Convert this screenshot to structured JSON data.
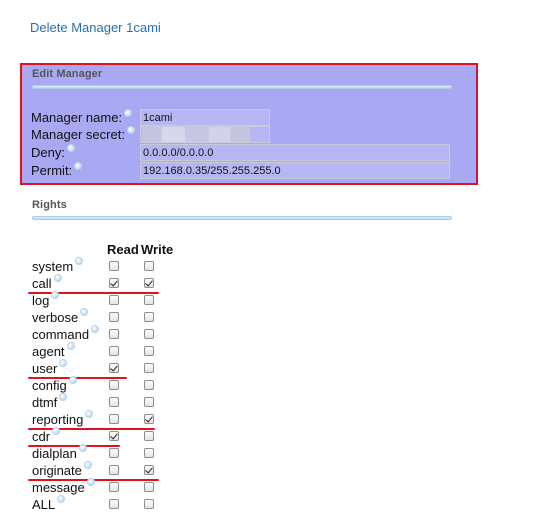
{
  "delete_link": "Delete Manager 1cami",
  "edit_manager": {
    "legend": "Edit Manager",
    "fields": {
      "name": {
        "label": "Manager name:",
        "value": "1cami"
      },
      "secret": {
        "label": "Manager secret:",
        "value": ""
      },
      "deny": {
        "label": "Deny:",
        "value": "0.0.0.0/0.0.0.0"
      },
      "permit": {
        "label": "Permit:",
        "value": "192.168.0.35/255.255.255.0"
      }
    }
  },
  "rights": {
    "legend": "Rights",
    "read_header": "Read",
    "write_header": "Write",
    "items": [
      {
        "label": "system",
        "read": false,
        "write": false,
        "highlighted": false
      },
      {
        "label": "call",
        "read": true,
        "write": true,
        "highlighted": true
      },
      {
        "label": "log",
        "read": false,
        "write": false,
        "highlighted": false
      },
      {
        "label": "verbose",
        "read": false,
        "write": false,
        "highlighted": false
      },
      {
        "label": "command",
        "read": false,
        "write": false,
        "highlighted": false
      },
      {
        "label": "agent",
        "read": false,
        "write": false,
        "highlighted": false
      },
      {
        "label": "user",
        "read": true,
        "write": false,
        "highlighted": true
      },
      {
        "label": "config",
        "read": false,
        "write": false,
        "highlighted": false
      },
      {
        "label": "dtmf",
        "read": false,
        "write": false,
        "highlighted": false
      },
      {
        "label": "reporting",
        "read": false,
        "write": true,
        "highlighted": true
      },
      {
        "label": "cdr",
        "read": true,
        "write": false,
        "highlighted": true
      },
      {
        "label": "dialplan",
        "read": false,
        "write": false,
        "highlighted": false
      },
      {
        "label": "originate",
        "read": false,
        "write": true,
        "highlighted": true
      },
      {
        "label": "message",
        "read": false,
        "write": false,
        "highlighted": false
      },
      {
        "label": "ALL",
        "read": false,
        "write": false,
        "highlighted": false
      }
    ]
  },
  "colors": {
    "highlight_box_bg": "#a9a8f2",
    "highlight_border": "#e0121f",
    "link": "#2a6fa8"
  }
}
